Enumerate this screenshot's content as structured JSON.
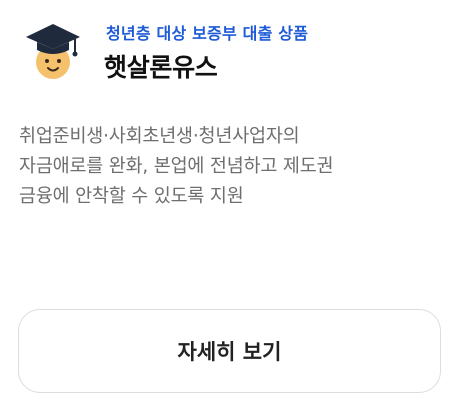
{
  "product": {
    "subtitle": "청년층 대상 보증부 대출 상품",
    "title": "햇살론유스",
    "description_lines": [
      "취업준비생·사회초년생·청년사업자의",
      "자금애로를 완화, 본업에 전념하고 제도권",
      "금융에 안착할 수 있도록 지원"
    ],
    "icon": "graduate-face-icon"
  },
  "actions": {
    "detail_label": "자세히 보기"
  },
  "colors": {
    "accent": "#1e5bd7",
    "title": "#111111",
    "description": "#6e6e6e",
    "button_border": "#dddddd",
    "mascot_face": "#f5c16c",
    "mascot_cap": "#1f2a3c"
  }
}
